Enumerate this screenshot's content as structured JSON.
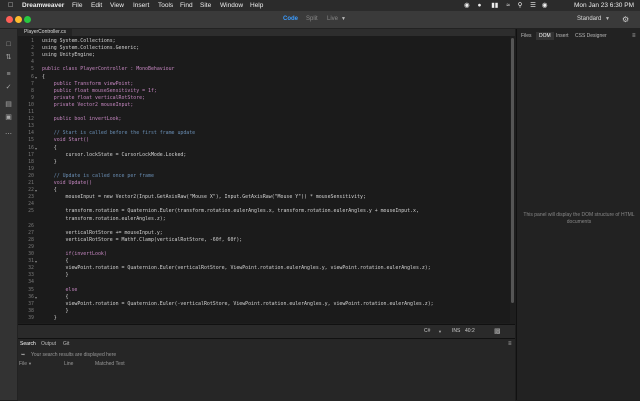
{
  "menubar": {
    "app": "Dreamweaver",
    "items": [
      "File",
      "Edit",
      "View",
      "Insert",
      "Tools",
      "Find",
      "Site",
      "Window",
      "Help"
    ],
    "datetime": "Mon Jan 23  6:30 PM"
  },
  "toolbar": {
    "code": "Code",
    "split": "Split",
    "live": "Live",
    "workspace": "Standard"
  },
  "file_tab": "PlayerController.cs",
  "editor": {
    "lines": [
      {
        "n": "1",
        "t": "using System.Collections;",
        "c": "#d4d4d4"
      },
      {
        "n": "2",
        "t": "using System.Collections.Generic;",
        "c": "#d4d4d4"
      },
      {
        "n": "3",
        "t": "using UnityEngine;",
        "c": "#d4d4d4"
      },
      {
        "n": "4",
        "t": "",
        "c": "#d4d4d4"
      },
      {
        "n": "5",
        "t": "public class PlayerController : MonoBehaviour",
        "c": "#c586c0"
      },
      {
        "n": "6",
        "t": "{",
        "c": "#d4d4d4"
      },
      {
        "n": "7",
        "t": "    public Transform viewPoint;",
        "c": "#c586c0"
      },
      {
        "n": "8",
        "t": "    public float mouseSensitivity = 1f;",
        "c": "#c586c0"
      },
      {
        "n": "9",
        "t": "    private float verticalRotStore;",
        "c": "#c586c0"
      },
      {
        "n": "10",
        "t": "    private Vector2 mouseInput;",
        "c": "#c586c0"
      },
      {
        "n": "11",
        "t": "",
        "c": "#d4d4d4"
      },
      {
        "n": "12",
        "t": "    public bool invertLook;",
        "c": "#c586c0"
      },
      {
        "n": "13",
        "t": "",
        "c": "#d4d4d4"
      },
      {
        "n": "14",
        "t": "    // Start is called before the first frame update",
        "c": "#6a8fb5"
      },
      {
        "n": "15",
        "t": "    void Start()",
        "c": "#c586c0"
      },
      {
        "n": "16",
        "t": "    {",
        "c": "#d4d4d4"
      },
      {
        "n": "17",
        "t": "        cursor.lockState = CursorLockMode.Locked;",
        "c": "#d4d4d4"
      },
      {
        "n": "18",
        "t": "    }",
        "c": "#d4d4d4"
      },
      {
        "n": "19",
        "t": "",
        "c": "#d4d4d4"
      },
      {
        "n": "20",
        "t": "    // Update is called once per frame",
        "c": "#6a8fb5"
      },
      {
        "n": "21",
        "t": "    void Update()",
        "c": "#c586c0"
      },
      {
        "n": "22",
        "t": "    {",
        "c": "#d4d4d4"
      },
      {
        "n": "23",
        "t": "        mouseInput = new Vector2(Input.GetAxisRaw(\"Mouse X\"), Input.GetAxisRaw(\"Mouse Y\")) * mouseSensitivity;",
        "c": "#d4d4d4"
      },
      {
        "n": "24",
        "t": "",
        "c": "#d4d4d4"
      },
      {
        "n": "25",
        "t": "        transform.rotation = Quaternion.Euler(transform.rotation.eulerAngles.x, transform.rotation.eulerAngles.y + mouseInput.x,",
        "c": "#d4d4d4"
      },
      {
        "n": "",
        "t": "        transform.rotation.eulerAngles.z);",
        "c": "#d4d4d4"
      },
      {
        "n": "26",
        "t": "",
        "c": "#d4d4d4"
      },
      {
        "n": "27",
        "t": "        verticalRotStore += mouseInput.y;",
        "c": "#d4d4d4"
      },
      {
        "n": "28",
        "t": "        verticalRotStore = Mathf.Clamp(verticalRotStore, -60f, 60f);",
        "c": "#d4d4d4"
      },
      {
        "n": "29",
        "t": "",
        "c": "#d4d4d4"
      },
      {
        "n": "30",
        "t": "        if(invertLook)",
        "c": "#c586c0"
      },
      {
        "n": "31",
        "t": "        {",
        "c": "#d4d4d4"
      },
      {
        "n": "32",
        "t": "        viewPoint.rotation = Quaternion.Euler(verticalRotStore, ViewPoint.rotation.eulerAngles.y, viewPoint.rotation.eulerAngles.z);",
        "c": "#d4d4d4"
      },
      {
        "n": "33",
        "t": "        }",
        "c": "#d4d4d4"
      },
      {
        "n": "34",
        "t": "",
        "c": "#d4d4d4"
      },
      {
        "n": "35",
        "t": "        else",
        "c": "#c586c0"
      },
      {
        "n": "36",
        "t": "        {",
        "c": "#d4d4d4"
      },
      {
        "n": "37",
        "t": "        viewPoint.rotation = Quaternion.Euler(-verticalRotStore, ViewPoint.rotation.eulerAngles.y, viewPoint.rotation.eulerAngles.z);",
        "c": "#d4d4d4"
      },
      {
        "n": "38",
        "t": "        }",
        "c": "#d4d4d4"
      },
      {
        "n": "39",
        "t": "    }",
        "c": "#d4d4d4"
      }
    ]
  },
  "status": {
    "language": "C#",
    "mode": "INS",
    "position": "40:2"
  },
  "right_panel": {
    "tabs": [
      "Files",
      "DOM",
      "Insert",
      "CSS Designer"
    ],
    "active_tab": "DOM",
    "message": "This panel will display the DOM structure of HTML documents"
  },
  "bottom_panel": {
    "tabs": [
      "Search",
      "Output",
      "Git"
    ],
    "active_tab": "Search",
    "search_placeholder": "Your search results are displayed here",
    "columns": [
      "File",
      "Line",
      "Matched Text"
    ]
  },
  "colors": {
    "accent": "#3b9cff",
    "close": "#ff5f57",
    "minimize": "#febc2e",
    "zoom": "#28c840"
  }
}
